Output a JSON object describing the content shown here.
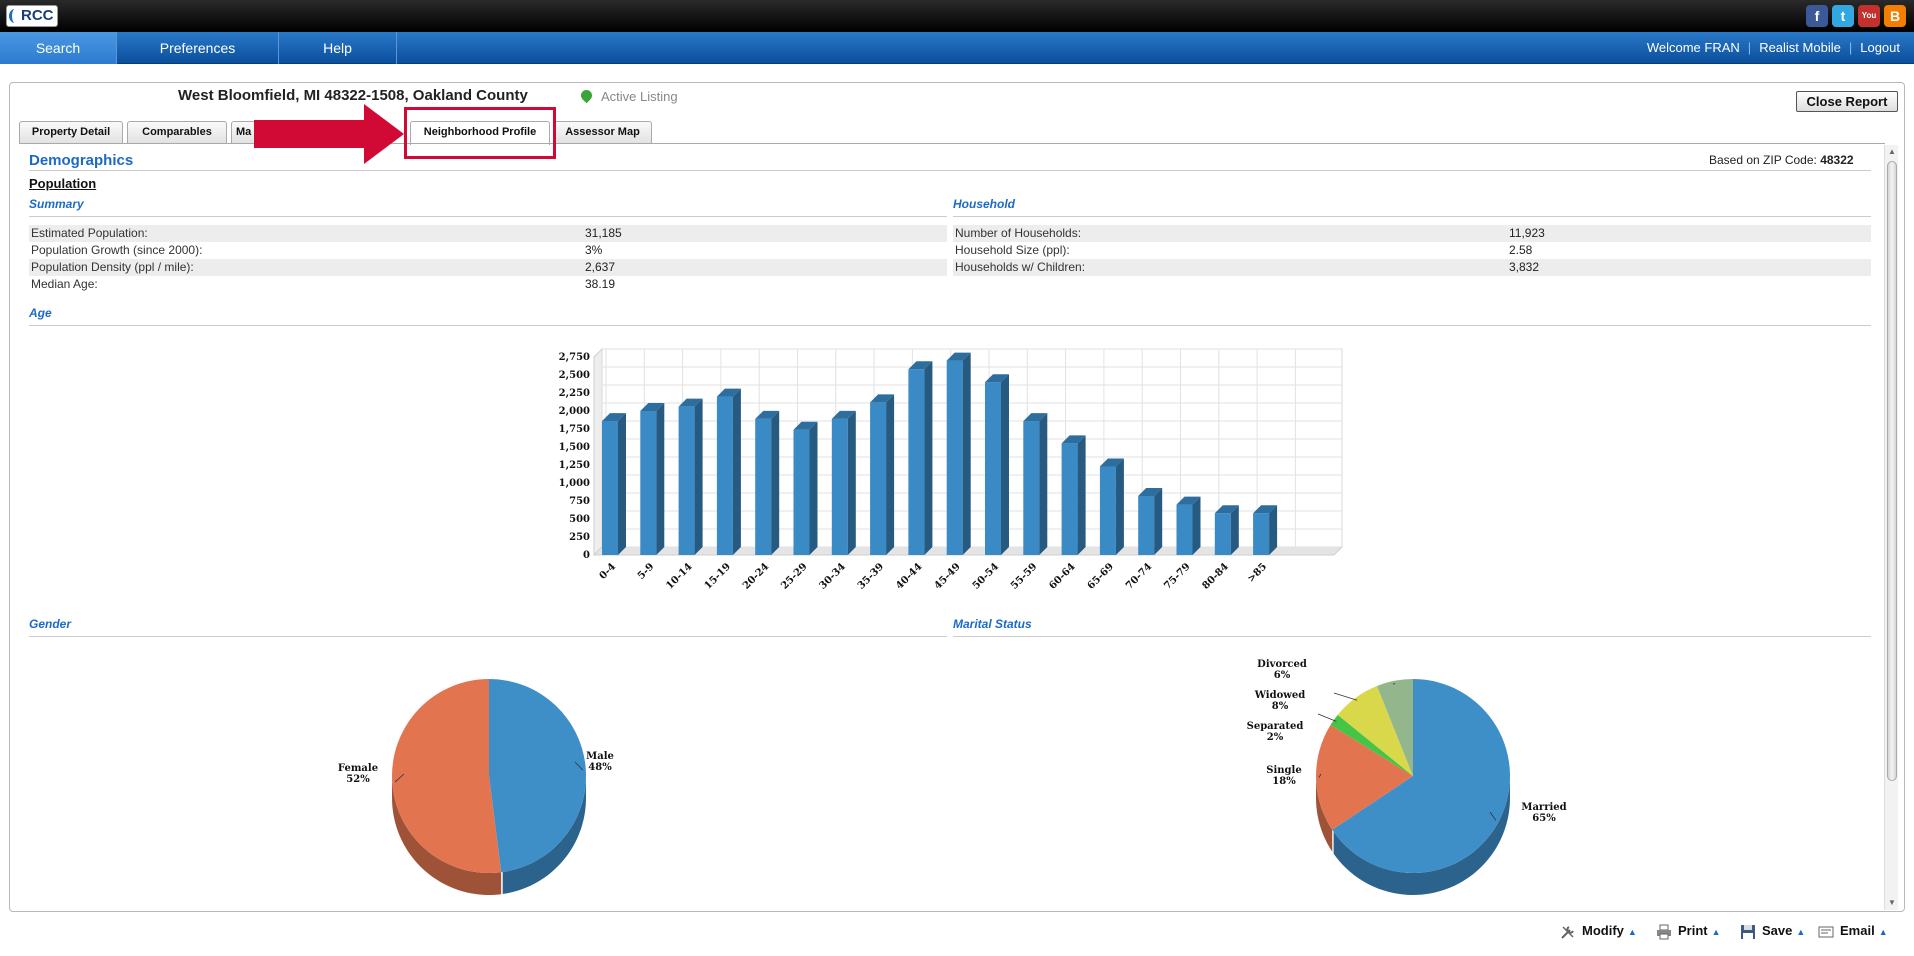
{
  "topbar": {
    "logo_text": "RCC",
    "social": [
      {
        "name": "facebook-icon",
        "glyph": "f",
        "color": "#3b5998"
      },
      {
        "name": "twitter-icon",
        "glyph": "t",
        "color": "#33a7e0"
      },
      {
        "name": "youtube-icon",
        "glyph": "You",
        "color": "#c4302b"
      },
      {
        "name": "blogger-icon",
        "glyph": "B",
        "color": "#f57d00"
      }
    ]
  },
  "nav": {
    "tabs": [
      "Search",
      "Preferences",
      "Help"
    ],
    "welcome": "Welcome FRAN",
    "mobile": "Realist Mobile",
    "logout": "Logout"
  },
  "header": {
    "address": "West Bloomfield, MI 48322-1508, Oakland County",
    "status": "Active Listing",
    "close_label": "Close Report"
  },
  "report_tabs": [
    "Property Detail",
    "Comparables",
    "Ma",
    "Neighborhood Profile",
    "Assessor Map"
  ],
  "demographics": {
    "title": "Demographics",
    "zip_label": "Based on ZIP Code:",
    "zip": "48322",
    "population_title": "Population",
    "summary_title": "Summary",
    "household_title": "Household",
    "age_title": "Age",
    "gender_title": "Gender",
    "marital_title": "Marital Status",
    "summary": [
      {
        "label": "Estimated Population:",
        "value": "31,185"
      },
      {
        "label": "Population Growth (since 2000):",
        "value": "3%"
      },
      {
        "label": "Population Density (ppl / mile):",
        "value": "2,637"
      },
      {
        "label": "Median Age:",
        "value": "38.19"
      }
    ],
    "household": [
      {
        "label": "Number of Households:",
        "value": "11,923"
      },
      {
        "label": "Household Size (ppl):",
        "value": "2.58"
      },
      {
        "label": "Households w/ Children:",
        "value": "3,832"
      }
    ]
  },
  "chart_data": [
    {
      "type": "bar",
      "title": "Age",
      "categories": [
        "0-4",
        "5-9",
        "10-14",
        "15-19",
        "20-24",
        "25-29",
        "30-34",
        "35-39",
        "40-44",
        "45-49",
        "50-54",
        "55-59",
        "60-64",
        "65-69",
        "70-74",
        "75-79",
        "80-84",
        ">85"
      ],
      "values": [
        1860,
        2000,
        2060,
        2200,
        1890,
        1740,
        1890,
        2120,
        2580,
        2700,
        2400,
        1860,
        1550,
        1230,
        820,
        700,
        580,
        580
      ],
      "ylim": [
        0,
        2750
      ],
      "yticks": [
        "0",
        "250",
        "500",
        "750",
        "1,000",
        "1,250",
        "1,500",
        "1,750",
        "2,000",
        "2,250",
        "2,500",
        "2,750"
      ],
      "color": "#3a8ac6",
      "grid": true
    },
    {
      "type": "pie",
      "title": "Gender",
      "slices": [
        {
          "label": "Male",
          "pct": "48%",
          "value": 48,
          "color": "#3e8ec8"
        },
        {
          "label": "Female",
          "pct": "52%",
          "value": 52,
          "color": "#e27550"
        }
      ]
    },
    {
      "type": "pie",
      "title": "Marital Status",
      "slices": [
        {
          "label": "Married",
          "pct": "65%",
          "value": 65,
          "color": "#3e8ec8"
        },
        {
          "label": "Single",
          "pct": "18%",
          "value": 18,
          "color": "#e27550"
        },
        {
          "label": "Separated",
          "pct": "2%",
          "value": 2,
          "color": "#45c445"
        },
        {
          "label": "Widowed",
          "pct": "8%",
          "value": 8,
          "color": "#d8d84a"
        },
        {
          "label": "Divorced",
          "pct": "6%",
          "value": 6,
          "color": "#93b68c"
        }
      ]
    }
  ],
  "footer": {
    "modify": "Modify",
    "print": "Print",
    "save": "Save",
    "email": "Email"
  }
}
